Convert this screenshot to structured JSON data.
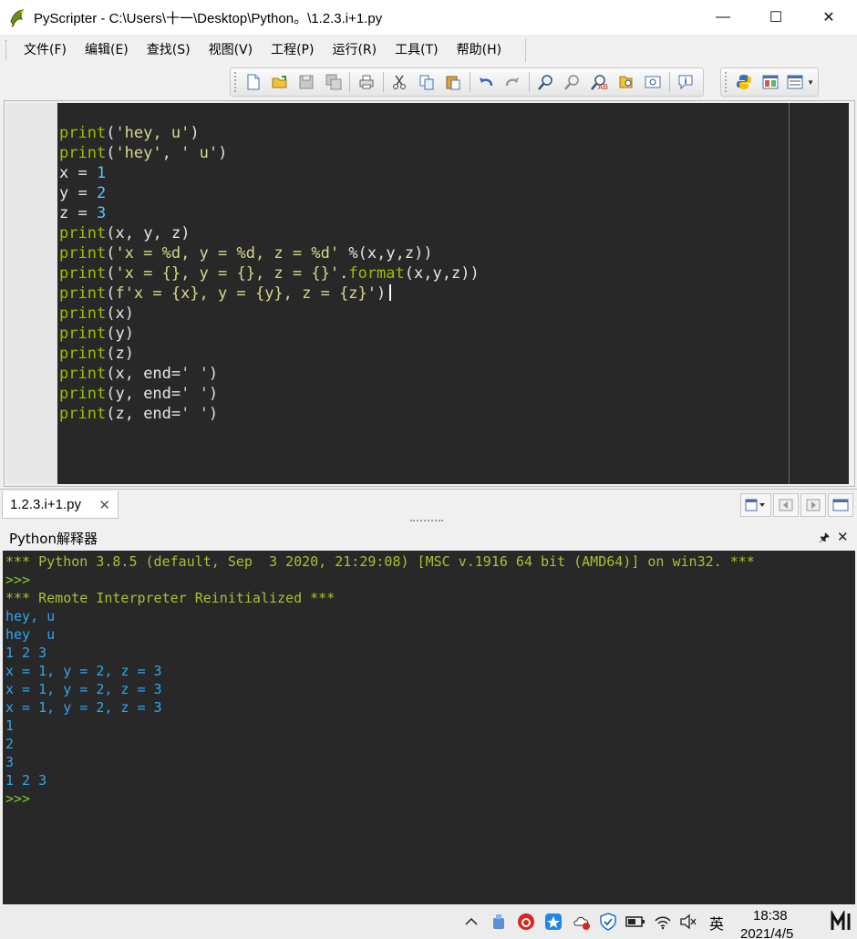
{
  "window": {
    "title": "PyScripter - C:\\Users\\十一\\Desktop\\Python。\\1.2.3.i+1.py",
    "minimize_glyph": "—",
    "maximize_glyph": "☐",
    "close_glyph": "✕"
  },
  "menu": [
    "文件(F)",
    "编辑(E)",
    "查找(S)",
    "视图(V)",
    "工程(P)",
    "运行(R)",
    "工具(T)",
    "帮助(H)"
  ],
  "toolbar": {
    "main_icons": [
      "new-file-icon",
      "open-file-icon",
      "save-icon",
      "save-all-icon",
      "print-icon",
      "cut-icon",
      "copy-icon",
      "paste-icon",
      "undo-icon",
      "redo-icon",
      "find-icon",
      "find-next-icon",
      "replace-icon",
      "find-in-files-icon",
      "goto-line-icon",
      "info-icon"
    ],
    "view_icons": [
      "python-icon",
      "layout-icon",
      "view-menu-icon"
    ]
  },
  "editor": {
    "lines": [
      "print('hey, u')",
      "print('hey', ' u')",
      "x = 1",
      "y = 2",
      "z = 3",
      "print(x, y, z)",
      "print('x = %d, y = %d, z = %d' %(x,y,z))",
      "print('x = {}, y = {}, z = {}'.format(x,y,z))",
      "print(f'x = {x}, y = {y}, z = {z}')",
      "print(x)",
      "print(y)",
      "print(z)",
      "print(x, end=' ')",
      "print(y, end=' ')",
      "print(z, end=' ')"
    ],
    "colors": {
      "background": "#282828",
      "keyword": "#98c000",
      "string": "#d8d88a",
      "number": "#4ec9ff",
      "text": "#e8e8e8"
    }
  },
  "tabs": {
    "file_tab_label": "1.2.3.i+1.py",
    "close_glyph": "✕"
  },
  "interpreter": {
    "title": "Python解释器",
    "pin_glyph": "🖈",
    "close_glyph": "✕",
    "lines": [
      {
        "kind": "banner",
        "text": "*** Python 3.8.5 (default, Sep  3 2020, 21:29:08) [MSC v.1916 64 bit (AMD64)] on win32. ***"
      },
      {
        "kind": "prompt",
        "text": ">>>"
      },
      {
        "kind": "banner",
        "text": "*** Remote Interpreter Reinitialized ***"
      },
      {
        "kind": "out",
        "text": "hey, u"
      },
      {
        "kind": "out",
        "text": "hey  u"
      },
      {
        "kind": "out",
        "text": "1 2 3"
      },
      {
        "kind": "out",
        "text": "x = 1, y = 2, z = 3"
      },
      {
        "kind": "out",
        "text": "x = 1, y = 2, z = 3"
      },
      {
        "kind": "out",
        "text": "x = 1, y = 2, z = 3"
      },
      {
        "kind": "out",
        "text": "1"
      },
      {
        "kind": "out",
        "text": "2"
      },
      {
        "kind": "out",
        "text": "3"
      },
      {
        "kind": "out",
        "text": "1 2 3"
      },
      {
        "kind": "prompt",
        "text": ">>>"
      }
    ],
    "colors": {
      "banner": "#a8c030",
      "prompt": "#7cd12a",
      "out": "#2ca8f0"
    }
  },
  "taskbar": {
    "tray_icons": [
      "chevron-up-icon",
      "usb-drive-icon",
      "netease-music-icon",
      "feishu-icon",
      "cloud-sync-icon",
      "shield-icon",
      "battery-icon",
      "wifi-icon",
      "volume-muted-icon"
    ],
    "ime": "英",
    "time": "18:38",
    "date": "2021/4/5"
  }
}
